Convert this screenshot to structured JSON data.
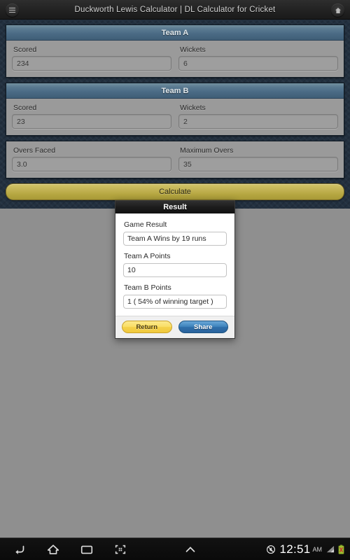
{
  "titlebar": {
    "title": "Duckworth Lewis Calculator | DL Calculator for Cricket",
    "left_icon": "menu-icon",
    "right_icon": "home-icon"
  },
  "app": {
    "sections": [
      {
        "title": "Team A",
        "fields": [
          {
            "label": "Scored",
            "value": "234"
          },
          {
            "label": "Wickets",
            "value": "6"
          }
        ]
      },
      {
        "title": "Team B",
        "fields": [
          {
            "label": "Scored",
            "value": "23"
          },
          {
            "label": "Wickets",
            "value": "2"
          }
        ]
      }
    ],
    "overs": {
      "fields": [
        {
          "label": "Overs Faced",
          "value": "3.0"
        },
        {
          "label": "Maximum Overs",
          "value": "35"
        }
      ]
    },
    "calculate_label": "Calculate"
  },
  "dialog": {
    "title": "Result",
    "fields": [
      {
        "label": "Game Result",
        "value": "Team A Wins by 19 runs"
      },
      {
        "label": "Team A Points",
        "value": "10"
      },
      {
        "label": "Team B Points",
        "value": "1 ( 54% of winning target )"
      }
    ],
    "buttons": {
      "return_label": "Return",
      "share_label": "Share"
    }
  },
  "navbar": {
    "icons": [
      "back-icon",
      "home-icon",
      "recents-icon",
      "screenshot-icon",
      "chevron-up-icon"
    ],
    "status": {
      "mute_icon": "mute-icon",
      "time": "12:51",
      "ampm": "AM",
      "signal_icon": "signal-icon",
      "battery_icon": "battery-error-icon"
    }
  },
  "colors": {
    "accent_gold": "#c3b455",
    "header_blue": "#4a6a84",
    "background_navy": "#22303f",
    "dim_gray": "#8f8f8f",
    "share_blue": "#3e82bb",
    "return_yellow": "#f9de66"
  }
}
